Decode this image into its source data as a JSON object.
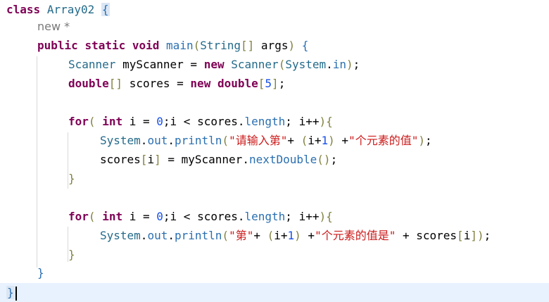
{
  "code": {
    "line1": {
      "kw_class": "class",
      "classname": "Array02",
      "open": "{"
    },
    "line2": {
      "hint": "new *"
    },
    "line3": {
      "kw_public": "public",
      "kw_static": "static",
      "kw_void": "void",
      "method": "main",
      "params_open": "(",
      "type": "String",
      "brackets": "[]",
      "args": "args",
      "params_close": ")",
      "open": "{"
    },
    "line4": {
      "type": "Scanner",
      "var": "myScanner",
      "eq": "=",
      "kw_new": "new",
      "ctor": "Scanner",
      "p_open": "(",
      "sys": "System",
      "dot": ".",
      "field": "in",
      "p_close": ")",
      "semi": ";"
    },
    "line5": {
      "kw_double": "double",
      "brackets": "[]",
      "var": "scores",
      "eq": "=",
      "kw_new": "new",
      "kw_double2": "double",
      "b_open": "[",
      "num": "5",
      "b_close": "]",
      "semi": ";"
    },
    "line7": {
      "kw_for": "for",
      "p_open": "(",
      "kw_int": "int",
      "init": " i = ",
      "zero": "0",
      "cond": ";i < scores.",
      "field": "length",
      "incr": "; i++",
      "p_close": ")",
      "open": "{"
    },
    "line8": {
      "sys": "System",
      "dot1": ".",
      "out": "out",
      "dot2": ".",
      "println": "println",
      "p_open": "(",
      "str1": "\"请输入第\"",
      "plus1": "+ ",
      "ip_open": "(",
      "expr": "i+",
      "one": "1",
      "ip_close": ")",
      "plus2": " +",
      "str2": "\"个元素的值\"",
      "p_close": ")",
      "semi": ";"
    },
    "line9": {
      "lhs": "scores",
      "ib_open": "[",
      "idx": "i",
      "ib_close": "]",
      "mid": " = myScanner.",
      "method": "nextDouble",
      "p_open": "(",
      "p_close": ")",
      "semi": ";"
    },
    "line10": {
      "close": "}"
    },
    "line12": {
      "kw_for": "for",
      "p_open": "(",
      "kw_int": "int",
      "init": " i = ",
      "zero": "0",
      "cond": ";i < scores.",
      "field": "length",
      "incr": "; i++",
      "p_close": ")",
      "open": "{"
    },
    "line13": {
      "sys": "System",
      "dot1": ".",
      "out": "out",
      "dot2": ".",
      "println": "println",
      "p_open": "(",
      "str1": "\"第\"",
      "plus1": "+ ",
      "ip_open": "(",
      "expr": "i+",
      "one": "1",
      "ip_close": ")",
      "plus2": " +",
      "str2": "\"个元素的值是\"",
      "plus3": " + scores",
      "ib_open": "[",
      "idx": "i",
      "ib_close": "]",
      "p_close": ")",
      "semi": ";"
    },
    "line14": {
      "close": "}"
    },
    "line15": {
      "close": "}"
    },
    "line16": {
      "close": "}"
    }
  },
  "colors": {
    "keyword": "#7f0055",
    "class": "#246a8a",
    "method": "#2a6fb0",
    "string": "#cc1a1a",
    "number": "#1750eb",
    "bracket": "#808040",
    "current_line": "#e8f2fe"
  }
}
